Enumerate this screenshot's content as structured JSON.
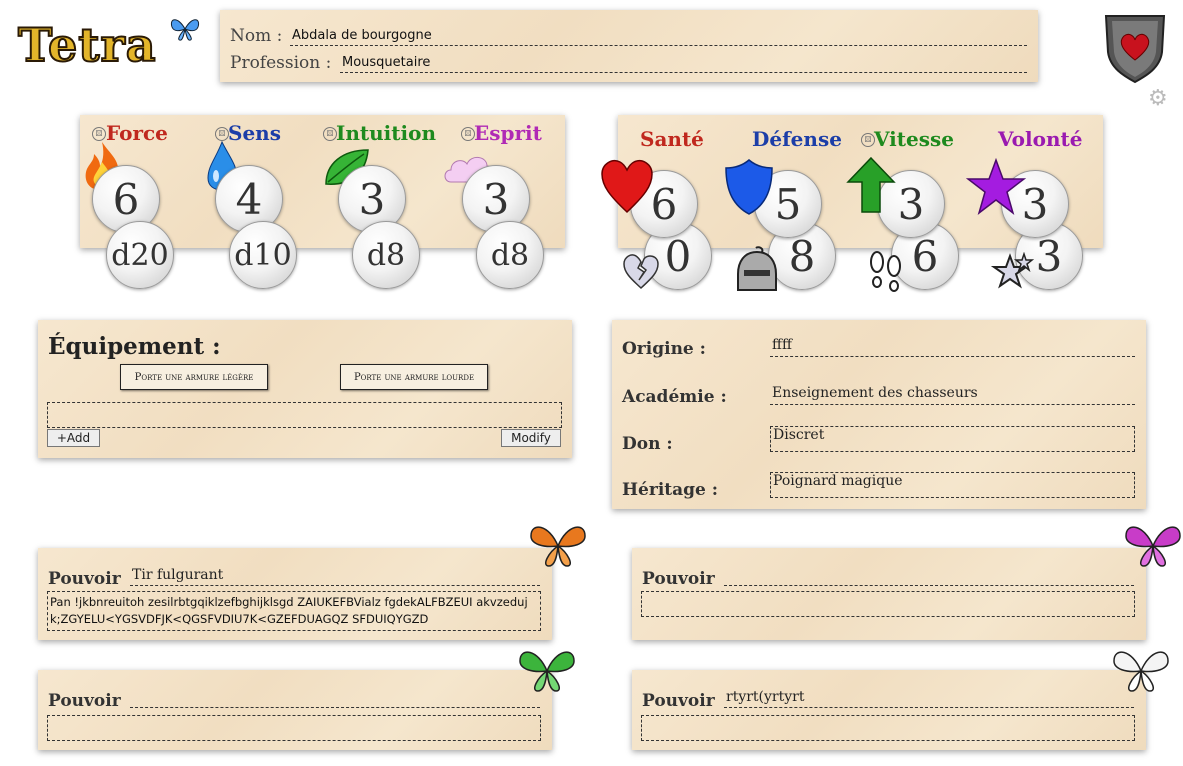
{
  "header": {
    "logo": "Tetra",
    "nom_label": "Nom :",
    "nom_value": "Abdala de bourgogne",
    "profession_label": "Profession :",
    "profession_value": "Mousquetaire"
  },
  "attributes": [
    {
      "name": "Force",
      "value": "6",
      "die": "d20",
      "color": "#c0281e",
      "icon": "fire-icon"
    },
    {
      "name": "Sens",
      "value": "4",
      "die": "d10",
      "color": "#1c3ea8",
      "icon": "water-drop-icon"
    },
    {
      "name": "Intuition",
      "value": "3",
      "die": "d8",
      "color": "#1e8a1e",
      "icon": "leaf-icon"
    },
    {
      "name": "Esprit",
      "value": "3",
      "die": "d8",
      "color": "#b02ab5",
      "icon": "cloud-icon"
    }
  ],
  "stats": [
    {
      "name": "Santé",
      "value": "6",
      "sub": "0",
      "color": "#c0281e",
      "icon": "heart-icon",
      "sub_icon": "broken-heart-icon"
    },
    {
      "name": "Défense",
      "value": "5",
      "sub": "8",
      "color": "#1c3ea8",
      "icon": "shield-icon",
      "sub_icon": "helmet-icon"
    },
    {
      "name": "Vitesse",
      "value": "3",
      "sub": "6",
      "color": "#1e8a1e",
      "icon": "arrow-up-icon",
      "sub_icon": "footprints-icon"
    },
    {
      "name": "Volonté",
      "value": "3",
      "sub": "3",
      "color": "#9a1ab0",
      "icon": "star-icon",
      "sub_icon": "stars-icon"
    }
  ],
  "equipment": {
    "title": "Équipement :",
    "light_armor": "Porte une armure légère",
    "heavy_armor": "Porte une armure lourde",
    "add": "+Add",
    "modify": "Modify"
  },
  "origin": {
    "origine_label": "Origine :",
    "origine_value": "ffff",
    "academie_label": "Académie :",
    "academie_value": "Enseignement des chasseurs",
    "don_label": "Don :",
    "don_value": "Discret",
    "heritage_label": "Héritage :",
    "heritage_value": "Poignard magique"
  },
  "powers": [
    {
      "label": "Pouvoir",
      "name": "Tir fulgurant",
      "desc": "Pan !jkbnreuitoh zesilrbtgqiklzefbghijklsgd ZAIUKEFBVialz fgdekALFBZEUI akvzedujk;ZGYELU<YGSVDFJK<QGSFVDIU7K<GZEFDUAGQZ SFDUIQYGZD",
      "butterfly": "#e8781e"
    },
    {
      "label": "Pouvoir",
      "name": "",
      "desc": "",
      "butterfly": "#c83cc8"
    },
    {
      "label": "Pouvoir",
      "name": "",
      "desc": "",
      "butterfly": "#3cb43c"
    },
    {
      "label": "Pouvoir",
      "name": "rtyrt(yrtyrt",
      "desc": "",
      "butterfly": "#f4f4f4"
    }
  ]
}
